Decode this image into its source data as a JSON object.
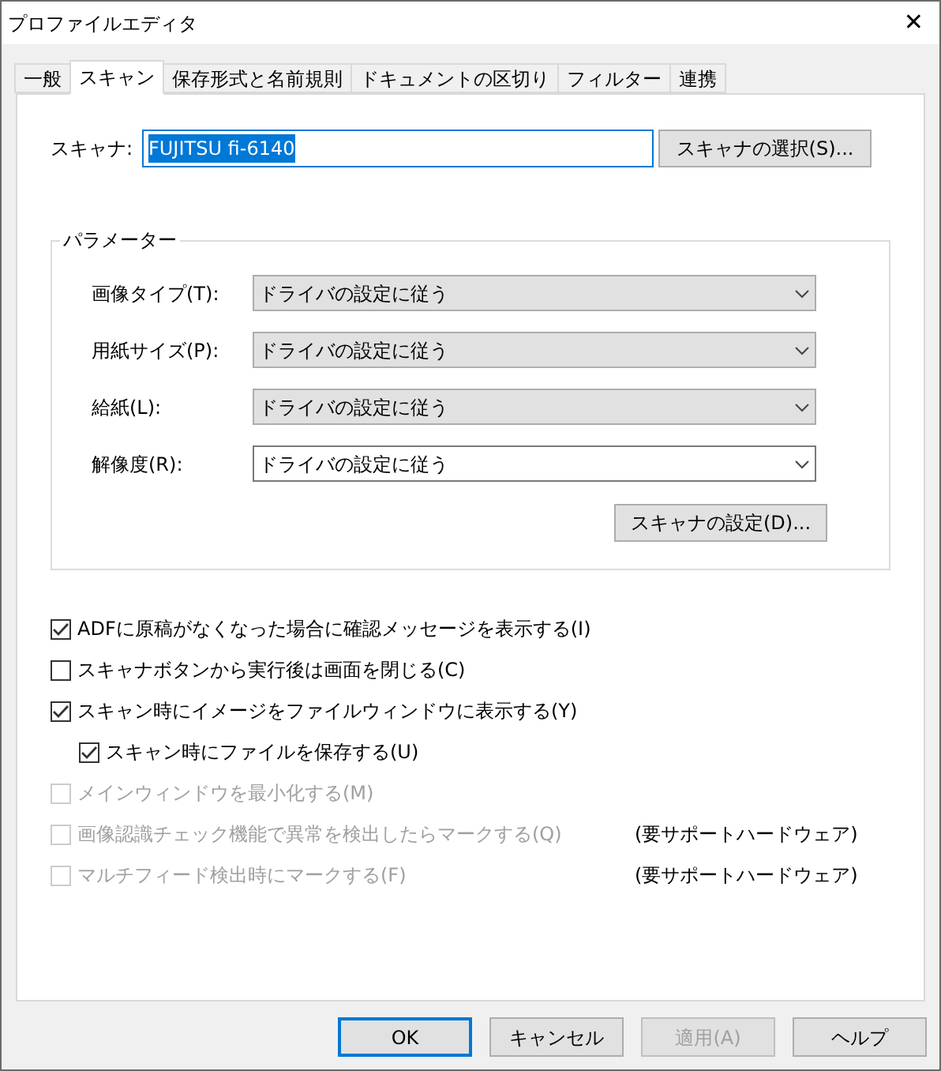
{
  "window": {
    "title": "プロファイルエディタ",
    "close": "✕"
  },
  "tabs": [
    {
      "label": "一般",
      "selected": false
    },
    {
      "label": "スキャン",
      "selected": true
    },
    {
      "label": "保存形式と名前規則",
      "selected": false
    },
    {
      "label": "ドキュメントの区切り",
      "selected": false
    },
    {
      "label": "フィルター",
      "selected": false
    },
    {
      "label": "連携",
      "selected": false
    }
  ],
  "scanner": {
    "label": "スキャナ:",
    "value": "FUJITSU fi-6140",
    "button": "スキャナの選択(S)..."
  },
  "parameters": {
    "title": "パラメーター",
    "fields": [
      {
        "label": "画像タイプ(T):",
        "value": "ドライバの設定に従う",
        "disabled": true
      },
      {
        "label": "用紙サイズ(P):",
        "value": "ドライバの設定に従う",
        "disabled": true
      },
      {
        "label": "給紙(L):",
        "value": "ドライバの設定に従う",
        "disabled": true
      },
      {
        "label": "解像度(R):",
        "value": "ドライバの設定に従う",
        "disabled": false
      }
    ],
    "button": "スキャナの設定(D)..."
  },
  "options": [
    {
      "label": "ADFに原稿がなくなった場合に確認メッセージを表示する(I)",
      "checked": true,
      "disabled": false
    },
    {
      "label": "スキャナボタンから実行後は画面を閉じる(C)",
      "checked": false,
      "disabled": false
    },
    {
      "label": "スキャン時にイメージをファイルウィンドウに表示する(Y)",
      "checked": true,
      "disabled": false,
      "children": [
        {
          "label": "スキャン時にファイルを保存する(U)",
          "checked": true,
          "disabled": false
        }
      ]
    },
    {
      "label": "メインウィンドウを最小化する(M)",
      "checked": false,
      "disabled": true
    },
    {
      "label": "画像認識チェック機能で異常を検出したらマークする(Q)",
      "checked": false,
      "disabled": true,
      "note": "(要サポートハードウェア)"
    },
    {
      "label": "マルチフィード検出時にマークする(F)",
      "checked": false,
      "disabled": true,
      "note": "(要サポートハードウェア)"
    }
  ],
  "buttons": [
    {
      "label": "OK",
      "kind": "default",
      "disabled": false
    },
    {
      "label": "キャンセル",
      "kind": "normal",
      "disabled": false
    },
    {
      "label": "適用(A)",
      "kind": "normal",
      "disabled": true
    },
    {
      "label": "ヘルプ",
      "kind": "normal",
      "disabled": false
    }
  ]
}
